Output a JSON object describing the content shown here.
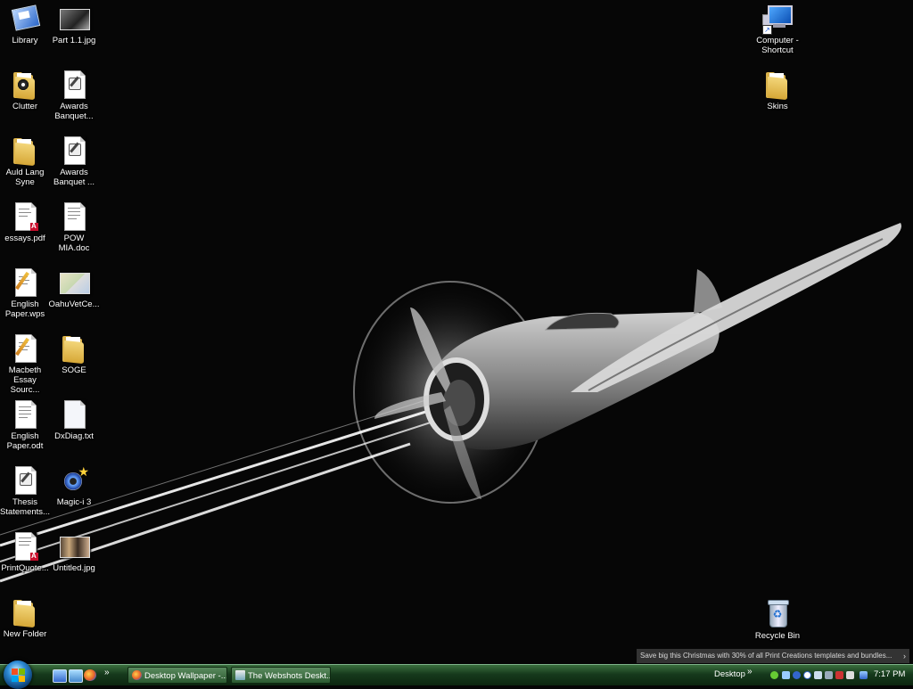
{
  "desktop": {
    "icons": [
      {
        "label": "Library",
        "icon": "library-icon"
      },
      {
        "label": "Part 1.1.jpg",
        "icon": "image-file-icon"
      },
      {
        "label": "Clutter",
        "icon": "folder-icon"
      },
      {
        "label": "Awards Banquet...",
        "icon": "document-icon"
      },
      {
        "label": "Auld Lang Syne",
        "icon": "folder-icon"
      },
      {
        "label": "Awards Banquet ...",
        "icon": "document-icon"
      },
      {
        "label": "essays.pdf",
        "icon": "pdf-file-icon"
      },
      {
        "label": "POW MIA.doc",
        "icon": "word-document-icon"
      },
      {
        "label": "English Paper.wps",
        "icon": "works-document-icon"
      },
      {
        "label": "OahuVetCe...",
        "icon": "image-file-icon"
      },
      {
        "label": "Macbeth Essay Sourc...",
        "icon": "works-document-icon"
      },
      {
        "label": "SOGE",
        "icon": "folder-icon"
      },
      {
        "label": "English Paper.odt",
        "icon": "document-icon"
      },
      {
        "label": "DxDiag.txt",
        "icon": "text-file-icon"
      },
      {
        "label": "Thesis Statements...",
        "icon": "document-icon"
      },
      {
        "label": "Magic-i 3",
        "icon": "magic-i-app-icon"
      },
      {
        "label": "PrintQuote...",
        "icon": "pdf-file-icon"
      },
      {
        "label": "Untitled.jpg",
        "icon": "image-file-icon"
      },
      {
        "label": "New Folder",
        "icon": "folder-icon"
      },
      {
        "label": "Computer - Shortcut",
        "icon": "computer-icon"
      },
      {
        "label": "Skins",
        "icon": "folder-icon"
      },
      {
        "label": "Recycle Bin",
        "icon": "recycle-bin-icon"
      }
    ]
  },
  "ad_banner": {
    "text": "Save big this Christmas with 30% of all Print Creations templates and bundles..."
  },
  "taskbar": {
    "quick_launch": [
      "show-desktop-icon",
      "switch-windows-icon",
      "firefox-icon"
    ],
    "buttons": [
      {
        "label": "Desktop Wallpaper -...",
        "icon": "firefox-icon"
      },
      {
        "label": "The Webshots Deskt...",
        "icon": "webshots-icon"
      }
    ],
    "toolbar_label": "Desktop",
    "clock": "7:17 PM"
  },
  "colors": {
    "taskbar": "#1d4a23",
    "wallpaper": "#060606"
  }
}
